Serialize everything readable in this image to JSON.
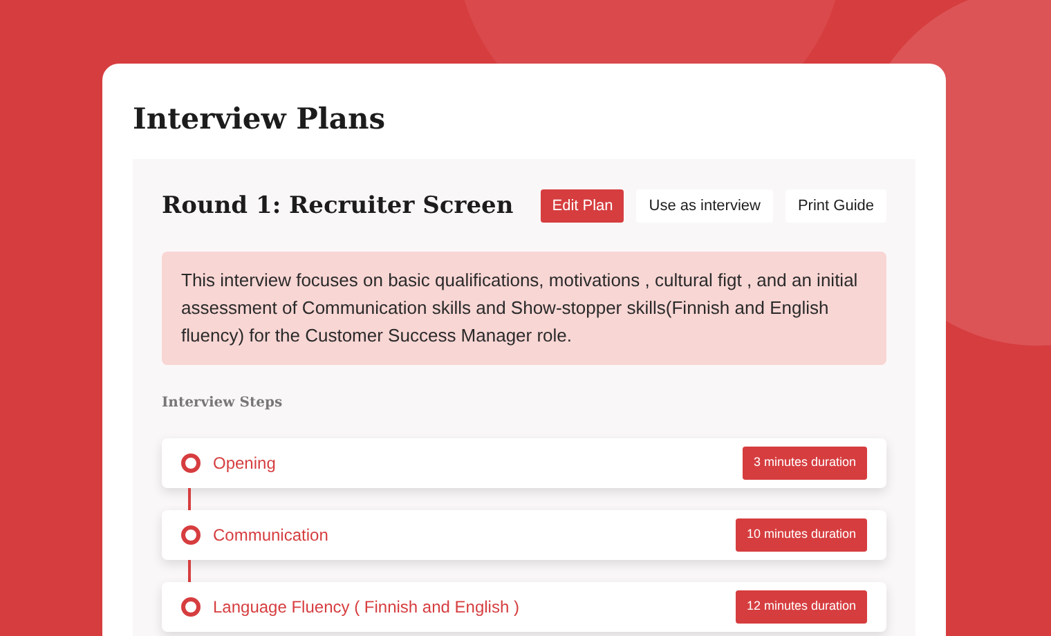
{
  "page": {
    "title": "Interview Plans"
  },
  "round": {
    "title": "Round 1: Recruiter Screen",
    "buttons": [
      {
        "label": "Edit Plan",
        "kind": "primary"
      },
      {
        "label": "Use as interview",
        "kind": "secondary"
      },
      {
        "label": "Print Guide",
        "kind": "secondary"
      }
    ],
    "description": "This interview focuses on basic qualifications, motivations , cultural figt , and an initial assessment of Communication skills and Show-stopper skills(Finnish and English fluency) for the Customer Success Manager role.",
    "steps_heading": "Interview Steps",
    "steps": [
      {
        "name": "Opening",
        "duration": "3 minutes duration"
      },
      {
        "name": "Communication",
        "duration": "10 minutes duration"
      },
      {
        "name": "Language Fluency ( Finnish and English )",
        "duration": "12 minutes duration"
      }
    ]
  }
}
